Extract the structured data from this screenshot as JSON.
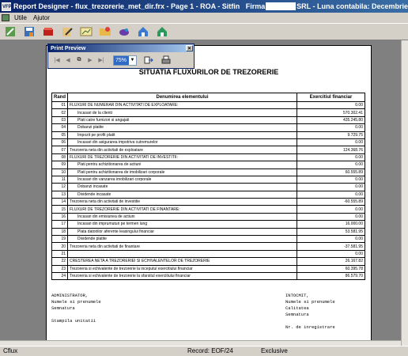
{
  "window": {
    "title_part1": "Report Designer - flux_trezorerie_met_dir.frx - Page 1 - ROA - Sitfin",
    "title_firma": "Firma",
    "title_part2": "SRL - Luna contabila: Decembrie"
  },
  "menu": {
    "items": [
      "Utile",
      "Ajutor"
    ]
  },
  "toolbar": {
    "icons": [
      "properties-icon",
      "save-icon",
      "delete-icon",
      "edit-icon",
      "chart-icon",
      "folder-icon",
      "run-icon",
      "home-icon",
      "home-alt-icon"
    ]
  },
  "preview": {
    "title": "Print Preview",
    "zoom": "75%"
  },
  "report": {
    "title": "SITUATIA FLUXURILOR DE TREZORERIE",
    "col_rand": "Rand",
    "col_denumire": "Denumirea elementului",
    "col_exercitiu": "Exercitiul financiar",
    "rows": [
      {
        "nr": "01",
        "den": "FLUXURI DE NUMERAR DIN ACTIVITATI DE EXPLOATARE:",
        "val": "0.00",
        "ind": false
      },
      {
        "nr": "02",
        "den": "Incasari de la clienti",
        "val": "570.302.41",
        "ind": true
      },
      {
        "nr": "03",
        "den": "Plati catre furnizori si angajati",
        "val": "435.245.80",
        "ind": true
      },
      {
        "nr": "04",
        "den": "Dobanzi platite",
        "val": "0.00",
        "ind": true
      },
      {
        "nr": "05",
        "den": "Impozit pe profit platit",
        "val": "9.729.75",
        "ind": true
      },
      {
        "nr": "06",
        "den": "Incasari din asigurarea impotriva cutremurelor",
        "val": "0.00",
        "ind": true
      },
      {
        "nr": "07",
        "den": "Trezoreria neta din activitati de exploatare",
        "val": "124.368.76",
        "ind": false
      },
      {
        "nr": "08",
        "den": "FLUXURI DE TREZORERIE DIN ACTIVITATI DE INVESTITII:",
        "val": "0.00",
        "ind": false
      },
      {
        "nr": "09",
        "den": "Plati pentru achizitionarea de actiuni",
        "val": "0.00",
        "ind": true
      },
      {
        "nr": "10",
        "den": "Plati pentru achizitionarea de imobilizari corporale",
        "val": "60.555.89",
        "ind": true
      },
      {
        "nr": "11",
        "den": "Incasari din vanzarea imobilizari corporale",
        "val": "0.00",
        "ind": true
      },
      {
        "nr": "12",
        "den": "Dobanzi incasate",
        "val": "0.00",
        "ind": true
      },
      {
        "nr": "13",
        "den": "Dividende incasate",
        "val": "0.00",
        "ind": true
      },
      {
        "nr": "14",
        "den": "Trezoreria neta din activitati de investitie",
        "val": "-60.555.89",
        "ind": false
      },
      {
        "nr": "15",
        "den": "FLUXURI DE TREZORERIE DIN ACTIVITATI DE FINANTARE:",
        "val": "0.00",
        "ind": false
      },
      {
        "nr": "16",
        "den": "Incasari din emisiunea de actiuni",
        "val": "0.00",
        "ind": true
      },
      {
        "nr": "17",
        "den": "Incasari din imprumuturi pe termen lung",
        "val": "16.000.00",
        "ind": true
      },
      {
        "nr": "18",
        "den": "Plata datoriilor aferente leasingului financiar",
        "val": "53.581.95",
        "ind": true
      },
      {
        "nr": "19",
        "den": "Dividende platite",
        "val": "0.00",
        "ind": true
      },
      {
        "nr": "20",
        "den": "Trezoreria neta din activitati de finantare",
        "val": "-37.581.95",
        "ind": false
      },
      {
        "nr": "21",
        "den": "",
        "val": "0.00",
        "ind": false
      },
      {
        "nr": "22",
        "den": "CRESTEREA NETA A TREZORERIEI SI ECHIVALENTELOR DE TREZORERIE",
        "val": "26.167.82",
        "ind": false
      },
      {
        "nr": "23",
        "den": "Trezoreria si echivalente de trezorerie la inceputul exercitiului financiar",
        "val": "60.395.78",
        "ind": false
      },
      {
        "nr": "24",
        "den": "Trezoreria si echivalente de trezorerie la sfarsitul exercitiului financiar",
        "val": "86.579.70",
        "ind": false
      }
    ],
    "sig_left": [
      "ADMINISTRATOR,",
      "Numele si prenumele",
      "Semnatura",
      "",
      "Stampila unitatii"
    ],
    "sig_right": [
      "INTOCMIT,",
      "Numele si prenumele",
      "Calitatea",
      "Semnatura",
      "",
      "Nr. de inregistrare"
    ]
  },
  "status": {
    "left": "Cflux",
    "record": "Record: EOF/24",
    "mode": "Exclusive"
  }
}
